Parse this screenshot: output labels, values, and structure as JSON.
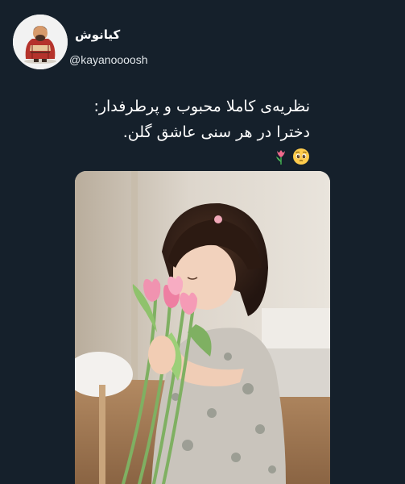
{
  "tweet": {
    "display_name": "کیانوش",
    "handle": "@kayanoooosh",
    "text_lines": [
      "نظریه‌ی کاملا محبوب و پرطرفدار:",
      "دخترا در هر سنی عاشق گلن."
    ],
    "emojis": [
      "pleading-face",
      "tulip"
    ],
    "avatar_icon": "cartoon-character-avatar",
    "media_description_icon": "photo-girl-with-tulips"
  },
  "colors": {
    "background": "#15202b",
    "text": "#ffffff",
    "handle": "#e1e6ea"
  }
}
